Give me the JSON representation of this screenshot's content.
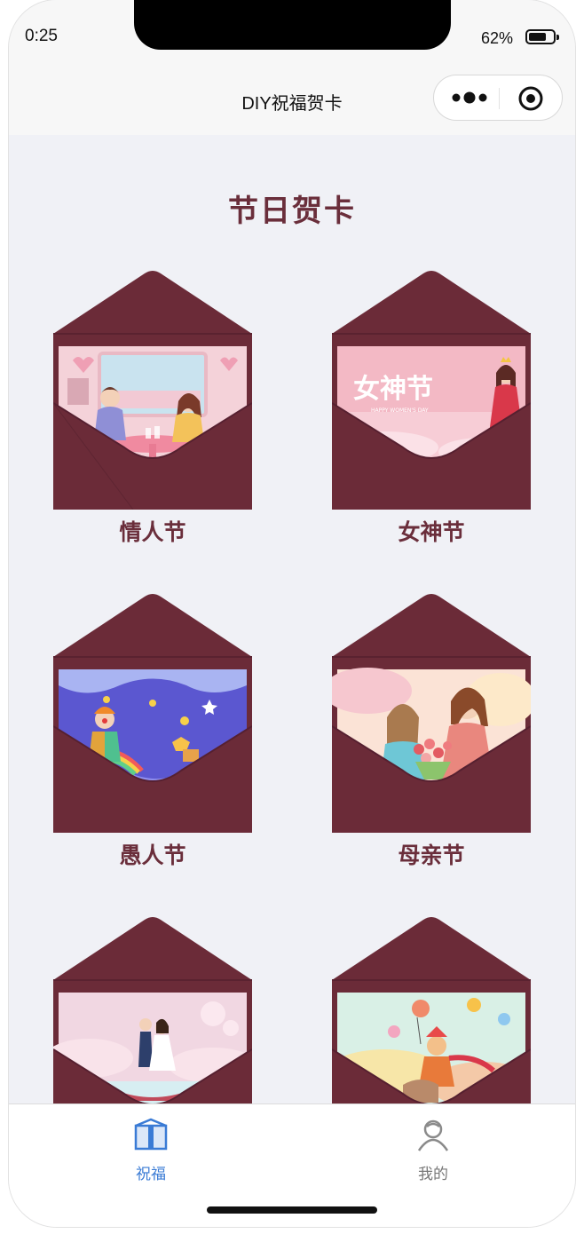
{
  "status_bar": {
    "time": "0:25",
    "battery": "62%"
  },
  "nav": {
    "title": "DIY祝福贺卡",
    "more_icon": "more-dots-icon",
    "close_icon": "target-icon"
  },
  "section_title": "节日贺卡",
  "cards": [
    {
      "label": "情人节",
      "scene": "valentine-couple-illustration"
    },
    {
      "label": "女神节",
      "scene": "goddess-day-illustration",
      "art_text": "女神节",
      "art_subtext": "HAPPY WOMEN'S DAY"
    },
    {
      "label": "愚人节",
      "scene": "april-fools-clown-illustration"
    },
    {
      "label": "母亲节",
      "scene": "mothers-day-flowers-illustration"
    },
    {
      "label": "",
      "scene": "wedding-boat-illustration"
    },
    {
      "label": "",
      "scene": "childrens-day-balloon-illustration"
    }
  ],
  "tabbar": {
    "tabs": [
      {
        "label": "祝福",
        "icon": "gift-box-icon",
        "active": true
      },
      {
        "label": "我的",
        "icon": "user-icon",
        "active": false
      }
    ],
    "active_color": "#3a7bd5",
    "inactive_color": "#777777"
  },
  "colors": {
    "envelope": "#6b2b38",
    "title": "#6a2e3b",
    "background": "#f0f1f6"
  }
}
